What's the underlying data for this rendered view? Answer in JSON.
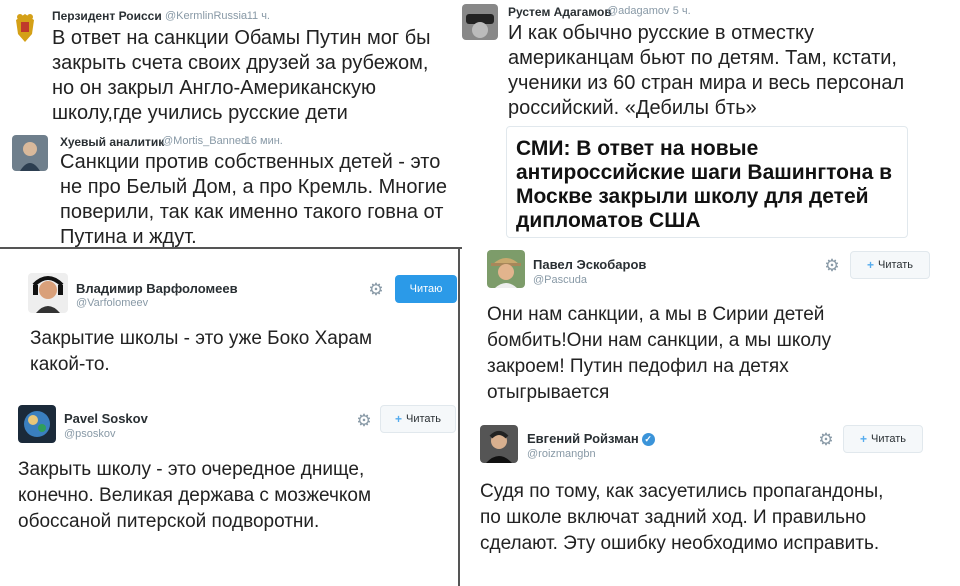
{
  "tweets": {
    "t1": {
      "name": "Перзидент Роисси",
      "handle": "@KermlinRussia",
      "time": "· 11 ч.",
      "text": "В ответ на санкции Обамы Путин мог бы закрыть счета своих друзей за рубежом, но он закрыл Англо-Американскую школу,где учились русские дети"
    },
    "t2": {
      "name": "Хуевый аналитик",
      "handle": "@Mortis_Banned",
      "time": "· 16 мин.",
      "text": "Санкции против собственных детей - это не про Белый Дом, а про Кремль. Многие поверили, так как именно такого говна от Путина и ждут."
    },
    "t3": {
      "name": "Рустем Адагамов",
      "handle": "@adagamov",
      "time": "· 5 ч.",
      "text": "И как обычно русские в отместку американцам бьют по детям. Там, кстати, ученики из 60 стран мира и весь персонал российский. «Дебилы бть»",
      "card_text": "СМИ: В ответ на новые антироссийские шаги Вашингтона в Москве закрыли школу для детей дипломатов США"
    },
    "t4": {
      "name": "Владимир Варфоломеев",
      "handle": "@Varfolomeev",
      "button": "Читаю",
      "text": "Закрытие школы - это уже Боко Харам какой-то."
    },
    "t5": {
      "name": "Pavel Soskov",
      "handle": "@psoskov",
      "button": "Читать",
      "text": "Закрыть школу - это очередное днище, конечно. Великая держава с мозжечком обоссаной питерской подворотни."
    },
    "t6": {
      "name": "Павел Эскобаров",
      "handle": "@Pascuda",
      "button": "Читать",
      "text": "Они нам санкции, а мы в Сирии детей бомбить!Они нам санкции, а мы школу закроем! Путин педофил на детях отыгрывается"
    },
    "t7": {
      "name": "Евгений Ройзман",
      "handle": "@roizmangbn",
      "button": "Читать",
      "text": "Судя по тому, как засуетились пропагандоны, по школе включат задний ход. И правильно сделают. Эту ошибку необходимо исправить."
    }
  },
  "icons": {
    "gear": "gear-icon",
    "follow": "follow-plus-icon",
    "verified": "verified-badge-icon"
  },
  "colors": {
    "accent": "#2b9ae8",
    "meta": "#8899a6"
  }
}
